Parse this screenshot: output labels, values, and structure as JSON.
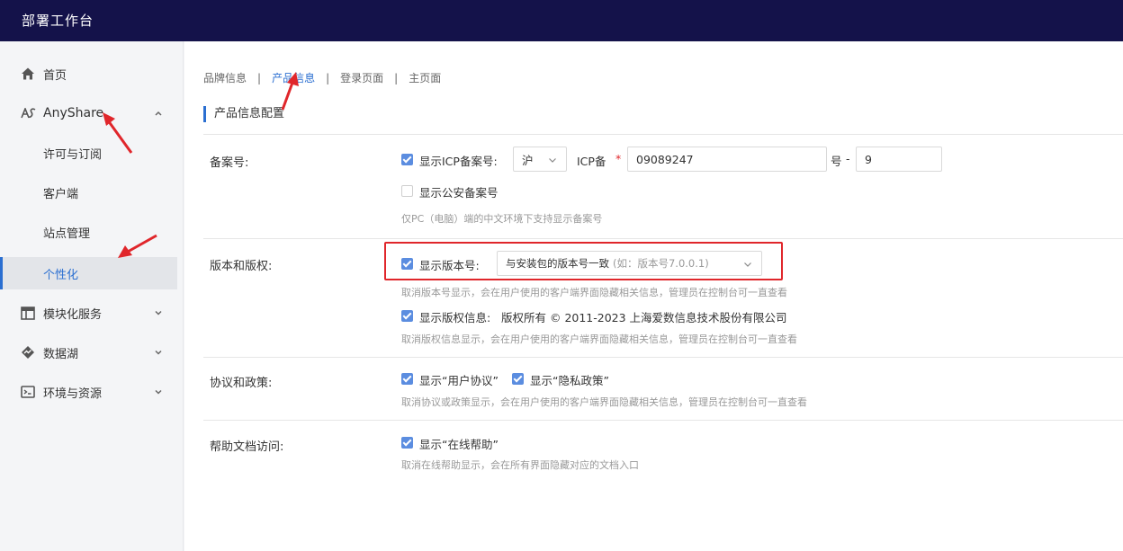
{
  "app": {
    "title": "部署工作台"
  },
  "sidebar": {
    "items": [
      {
        "label": "首页",
        "icon": "home-icon"
      },
      {
        "label": "AnyShare",
        "icon": "anyshare-logo-icon",
        "expanded": true
      },
      {
        "label": "许可与订阅",
        "sub": true
      },
      {
        "label": "客户端",
        "sub": true
      },
      {
        "label": "站点管理",
        "sub": true
      },
      {
        "label": "个性化",
        "sub": true,
        "active": true
      },
      {
        "label": "模块化服务",
        "icon": "module-icon"
      },
      {
        "label": "数据湖",
        "icon": "datalake-icon"
      },
      {
        "label": "环境与资源",
        "icon": "environment-icon"
      }
    ]
  },
  "tabs": [
    {
      "label": "品牌信息"
    },
    {
      "label": "产品信息",
      "active": true
    },
    {
      "label": "登录页面"
    },
    {
      "label": "主页面"
    }
  ],
  "section": {
    "title": "产品信息配置"
  },
  "icp": {
    "label": "备案号:",
    "show_icp_label": "显示ICP备案号:",
    "province": "沪",
    "icp_prefix": "ICP备",
    "required_mark": "*",
    "icp_number": "09089247",
    "hao": "号",
    "dash": "-",
    "suffix_number": "9",
    "show_police_label": "显示公安备案号",
    "hint": "仅PC（电脑）端的中文环境下支持显示备案号"
  },
  "version": {
    "label": "版本和版权:",
    "show_version_label": "显示版本号:",
    "version_select_value": "与安装包的版本号一致",
    "version_select_hint": "(如：版本号7.0.0.1)",
    "version_hint": "取消版本号显示，会在用户使用的客户端界面隐藏相关信息，管理员在控制台可一直查看",
    "show_copyright_label": "显示版权信息:",
    "copyright_text": "版权所有 © 2011-2023 上海爱数信息技术股份有限公司",
    "copyright_hint": "取消版权信息显示，会在用户使用的客户端界面隐藏相关信息，管理员在控制台可一直查看"
  },
  "policy": {
    "label": "协议和政策:",
    "user_agreement": "显示“用户协议”",
    "privacy_policy": "显示“隐私政策”",
    "hint": "取消协议或政策显示，会在用户使用的客户端界面隐藏相关信息，管理员在控制台可一直查看"
  },
  "help": {
    "label": "帮助文档访问:",
    "online_help": "显示“在线帮助”",
    "hint": "取消在线帮助显示，会在所有界面隐藏对应的文档入口"
  },
  "colors": {
    "topbar": "#14124a",
    "accent": "#2b6fd1",
    "checkbox": "#5b8de0",
    "annotation": "#e0262b"
  }
}
